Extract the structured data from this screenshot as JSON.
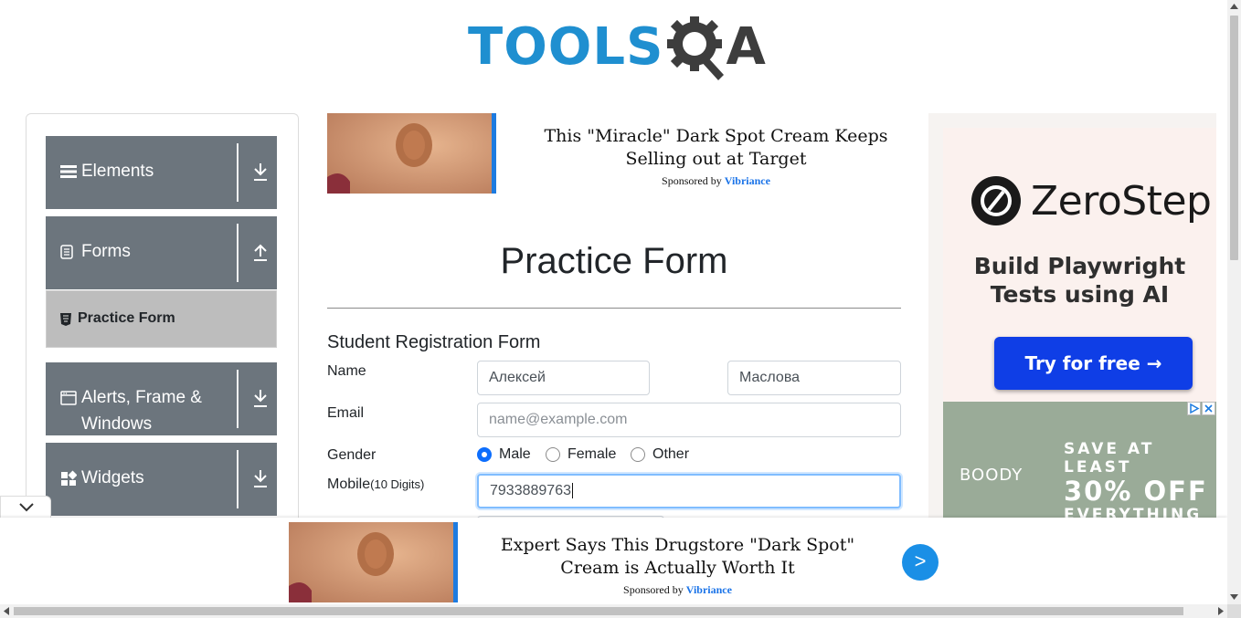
{
  "logo": {
    "part1": "TOOLS",
    "part2": "A",
    "brand_color": "#1f8fd0"
  },
  "sidebar": {
    "groups": [
      {
        "label": "Elements",
        "icon": "hamburger-icon",
        "arrow": "download-icon"
      },
      {
        "label": "Forms",
        "icon": "document-icon",
        "arrow": "upload-icon"
      },
      {
        "label": "Alerts, Frame & Windows",
        "icon": "window-icon",
        "arrow": "download-icon"
      },
      {
        "label": "Widgets",
        "icon": "widgets-icon",
        "arrow": "download-icon"
      }
    ],
    "active_item": {
      "label": "Practice Form",
      "icon": "html5-icon"
    }
  },
  "top_ad": {
    "title": "This \"Miracle\" Dark Spot Cream Keeps Selling out at Target",
    "sponsored_by": "Sponsored by",
    "sponsor": "Vibriance"
  },
  "main": {
    "page_title": "Practice Form",
    "form_title": "Student Registration Form",
    "name_label": "Name",
    "first_name": "Алексей",
    "last_name": "Маслова",
    "email_label": "Email",
    "email_placeholder": "name@example.com",
    "gender_label": "Gender",
    "gender_options": [
      "Male",
      "Female",
      "Other"
    ],
    "gender_selected": "Male",
    "mobile_label": "Mobile",
    "mobile_hint": "(10 Digits)",
    "mobile_value": "7933889763"
  },
  "right_ad": {
    "brand": "ZeroStep",
    "tagline": "Build Playwright Tests using AI",
    "button": "Try for free →",
    "button_color": "#0f3ee6",
    "boody_logo": "BOODY",
    "boody_line1": "SAVE AT LEAST",
    "boody_line2": "30% OFF",
    "boody_line3": "EVERYTHING"
  },
  "bottom_ad": {
    "title": "Expert Says This Drugstore \"Dark Spot\" Cream is Actually Worth It",
    "sponsored_by": "Sponsored by",
    "sponsor": "Vibriance",
    "next": ">"
  }
}
